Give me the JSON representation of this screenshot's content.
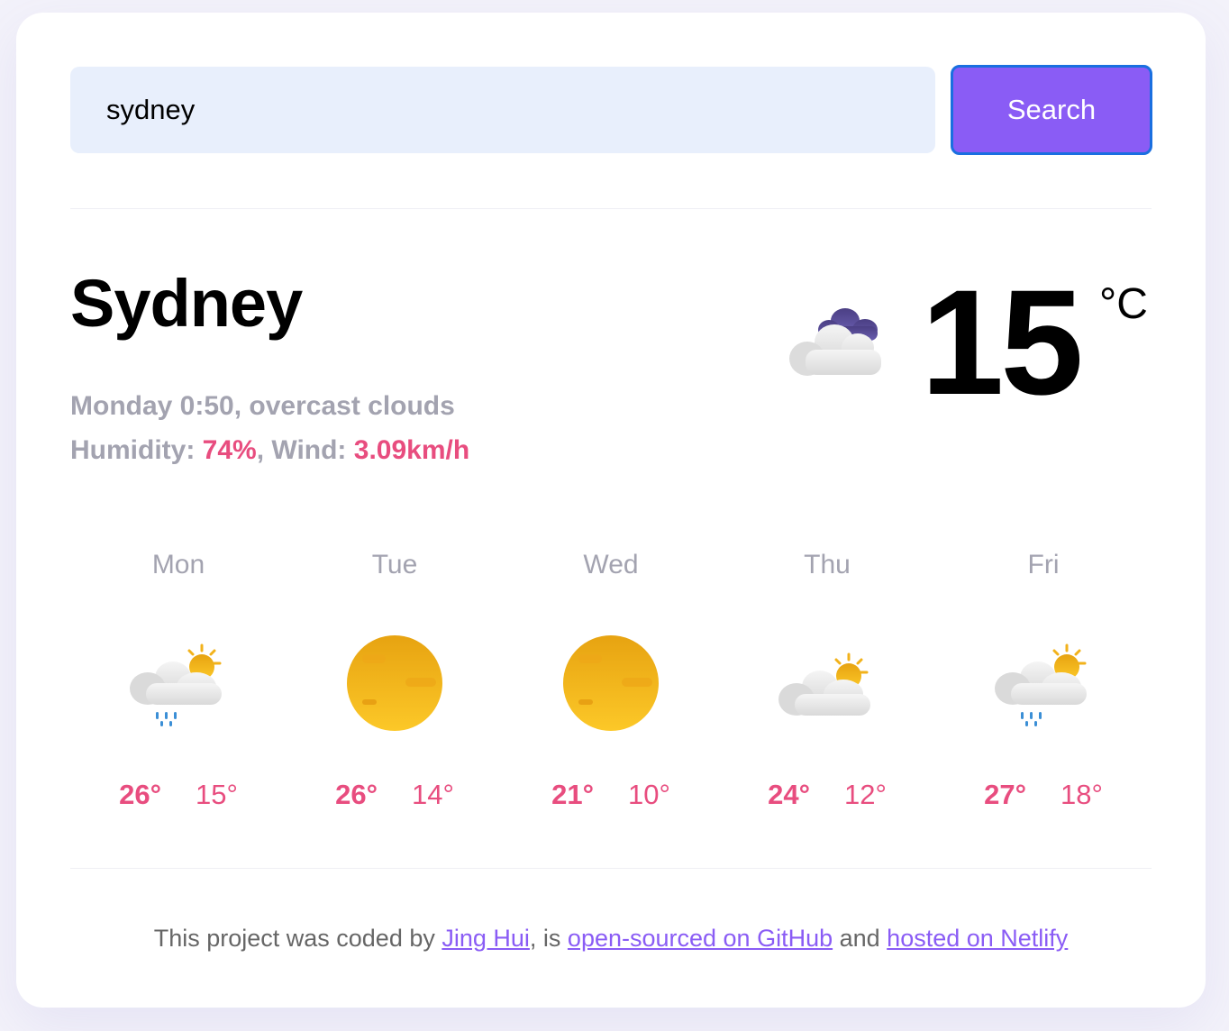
{
  "search": {
    "value": "sydney",
    "button_label": "Search"
  },
  "current": {
    "city": "Sydney",
    "day_time": "Monday 0:50",
    "description": "overcast clouds",
    "humidity_label": "Humidity: ",
    "humidity": "74%",
    "wind_label": "Wind: ",
    "wind": "3.09km/h",
    "temperature": "15",
    "unit": "°C",
    "icon": "overcast-clouds-icon"
  },
  "forecast": [
    {
      "day": "Mon",
      "max": "26°",
      "min": "15°",
      "icon": "sun-cloud-rain-icon"
    },
    {
      "day": "Tue",
      "max": "26°",
      "min": "14°",
      "icon": "sun-icon"
    },
    {
      "day": "Wed",
      "max": "21°",
      "min": "10°",
      "icon": "sun-icon"
    },
    {
      "day": "Thu",
      "max": "24°",
      "min": "12°",
      "icon": "sun-cloud-icon"
    },
    {
      "day": "Fri",
      "max": "27°",
      "min": "18°",
      "icon": "sun-cloud-rain-icon"
    }
  ],
  "footer": {
    "prefix": "This project was coded by ",
    "author": "Jing Hui",
    "middle1": ", is ",
    "repo_link": "open-sourced on GitHub",
    "middle2": " and ",
    "host_link": "hosted on Netlify"
  },
  "colors": {
    "accent": "#e84d7f",
    "button": "#8a5cf5",
    "input_bg": "#e8effc",
    "muted": "#a3a3b0"
  }
}
